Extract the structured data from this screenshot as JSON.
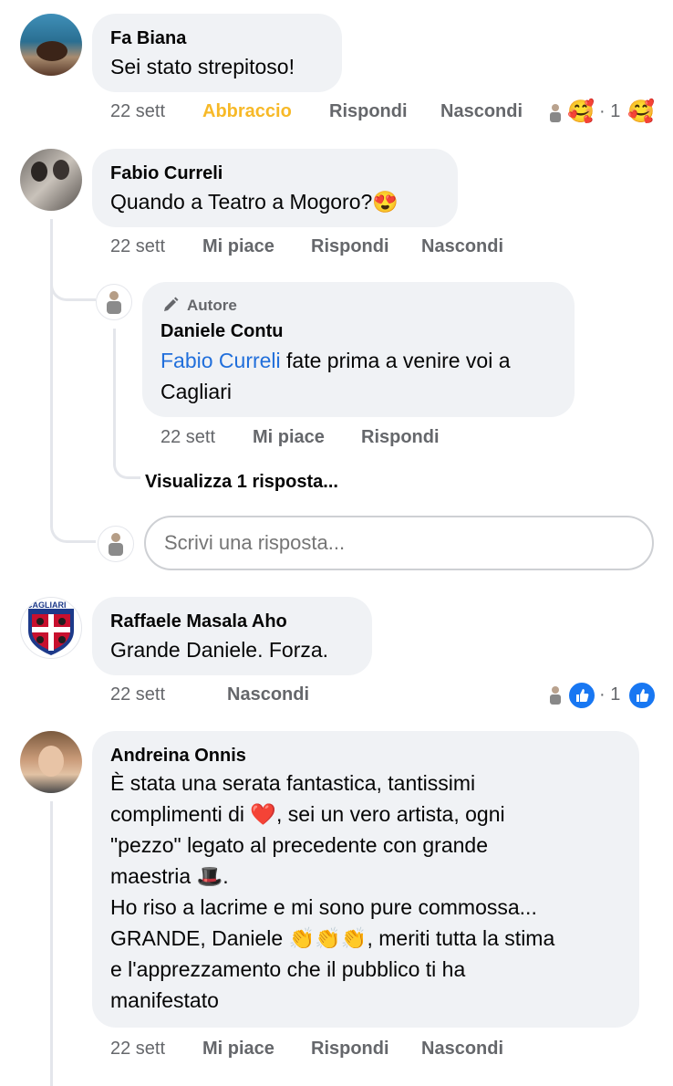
{
  "comments": [
    {
      "author": "Fa Biana",
      "text": "Sei stato strepitoso!",
      "time": "22 sett",
      "reaction_label": "Abbraccio",
      "reply_label": "Rispondi",
      "hide_label": "Nascondi",
      "reaction_count": "· 1",
      "reaction_icon": "care-emoji-icon"
    },
    {
      "author": "Fabio Curreli",
      "text": "Quando a Teatro a Mogoro?",
      "emoji": "😍",
      "time": "22 sett",
      "like_label": "Mi piace",
      "reply_label": "Rispondi",
      "hide_label": "Nascondi"
    },
    {
      "author": "Raffaele Masala Aho",
      "text": "Grande Daniele. Forza.",
      "time": "22 sett",
      "hide_label": "Nascondi",
      "reaction_count": "· 1",
      "reaction_icon": "like-icon",
      "avatar_label": "CAGLIARI"
    },
    {
      "author": "Andreina Onnis",
      "lines": [
        "È stata una serata fantastica, tantissimi",
        "complimenti di ❤️, sei un vero artista, ogni",
        "\"pezzo\" legato al precedente con grande",
        "maestria 🎩.",
        "Ho riso a lacrime e mi sono pure commossa...",
        "GRANDE, Daniele 👏👏👏, meriti tutta la stima",
        "e l'apprezzamento che il pubblico ti ha",
        "manifestato"
      ],
      "time": "22 sett",
      "like_label": "Mi piace",
      "reply_label": "Rispondi",
      "hide_label": "Nascondi"
    }
  ],
  "reply": {
    "badge": "Autore",
    "author": "Daniele Contu",
    "mention": "Fabio Curreli",
    "text_line1": " fate prima a venire voi a",
    "text_line2": "Cagliari",
    "time": "22 sett",
    "like_label": "Mi piace",
    "reply_label": "Rispondi"
  },
  "view_replies": "Visualizza 1 risposta...",
  "reply_input": {
    "placeholder": "Scrivi una risposta..."
  },
  "colors": {
    "bubble": "#f0f2f5",
    "meta": "#65676b",
    "link": "#216fdb",
    "abbraccio": "#f7b928",
    "like_blue": "#1877f2"
  }
}
